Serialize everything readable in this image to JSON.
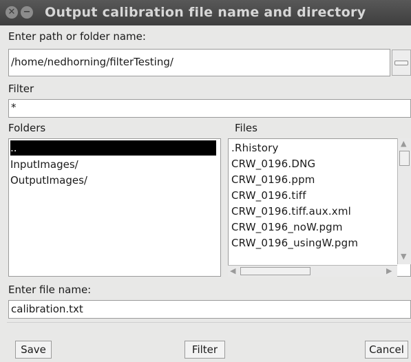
{
  "window": {
    "title": "Output calibration file name and directory",
    "close_glyph": "✕",
    "minimize_glyph": "−"
  },
  "path": {
    "label": "Enter path or folder name:",
    "value": "/home/nedhorning/filterTesting/"
  },
  "filter": {
    "label": "Filter",
    "value": "*"
  },
  "folders": {
    "label": "Folders",
    "items": [
      "..",
      "InputImages/",
      "OutputImages/"
    ]
  },
  "files": {
    "label": "Files",
    "items": [
      ".Rhistory",
      "CRW_0196.DNG",
      "CRW_0196.ppm",
      "CRW_0196.tiff",
      "CRW_0196.tiff.aux.xml",
      "CRW_0196_noW.pgm",
      "CRW_0196_usingW.pgm"
    ]
  },
  "filename": {
    "label": "Enter file name:",
    "value": "calibration.txt"
  },
  "buttons": {
    "save": "Save",
    "filter": "Filter",
    "cancel": "Cancel"
  },
  "icons": {
    "close": "close-icon",
    "minimize": "minimize-icon",
    "folder_browse": "folder-browse-icon"
  }
}
